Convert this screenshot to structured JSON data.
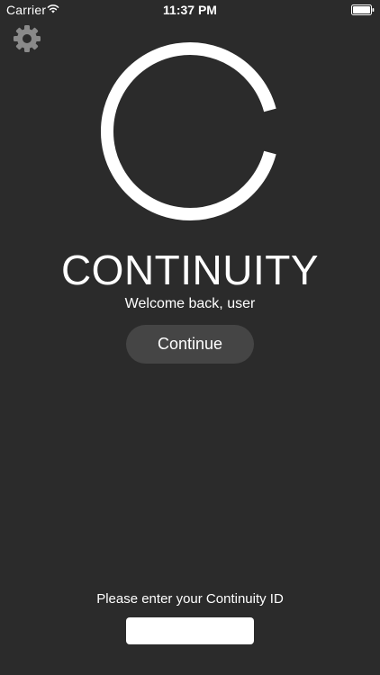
{
  "status_bar": {
    "carrier": "Carrier",
    "time": "11:37 PM",
    "wifi_icon": "wifi-icon",
    "battery_icon": "battery-icon"
  },
  "header": {
    "settings_icon": "gear-icon"
  },
  "logo": {
    "icon": "continuity-ring-logo"
  },
  "main": {
    "title": "CONTINUITY",
    "welcome": "Welcome back, user",
    "continue_label": "Continue"
  },
  "footer": {
    "id_prompt": "Please enter your Continuity ID",
    "id_value": "",
    "id_placeholder": ""
  },
  "colors": {
    "background": "#2b2b2b",
    "button": "#454545",
    "text": "#ffffff"
  }
}
